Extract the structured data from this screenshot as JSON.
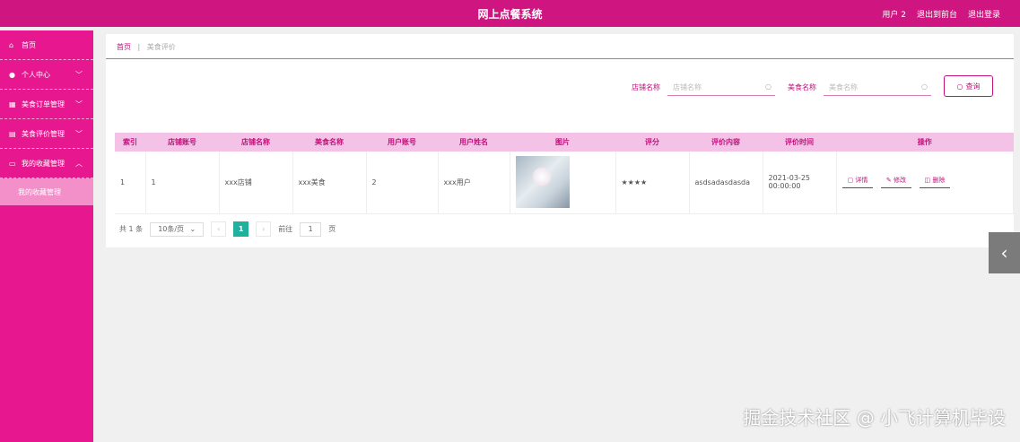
{
  "header": {
    "title": "网上点餐系统",
    "user": "用户 2",
    "exit_console": "退出到前台",
    "logout": "退出登录"
  },
  "sidebar": {
    "items": [
      {
        "icon": "home-icon",
        "label": "首页",
        "arrow": ""
      },
      {
        "icon": "user-icon",
        "label": "个人中心",
        "arrow": "﹀"
      },
      {
        "icon": "order-icon",
        "label": "美食订单管理",
        "arrow": "﹀"
      },
      {
        "icon": "review-icon",
        "label": "美食评价管理",
        "arrow": "﹀"
      },
      {
        "icon": "collect-icon",
        "label": "我的收藏管理",
        "arrow": "︿"
      }
    ],
    "sub_item": "我的收藏管理"
  },
  "breadcrumb": {
    "home": "首页",
    "sep": "|",
    "current": "美食评价"
  },
  "search": {
    "shop_label": "店铺名称",
    "shop_placeholder": "店铺名称",
    "food_label": "美食名称",
    "food_placeholder": "美食名称",
    "query_button": "查询"
  },
  "table": {
    "headers": [
      "索引",
      "店铺账号",
      "店铺名称",
      "美食名称",
      "用户账号",
      "用户姓名",
      "图片",
      "评分",
      "评价内容",
      "评价时间",
      "操作"
    ],
    "rows": [
      {
        "index": "1",
        "shop_account": "1",
        "shop_name": "xxx店铺",
        "food_name": "xxx美食",
        "user_account": "2",
        "user_name": "xxx用户",
        "rating": "★★★★",
        "content": "asdsadasdasda",
        "time": "2021-03-25 00:00:00",
        "actions": {
          "detail": "详情",
          "edit": "修改",
          "delete": "删除"
        }
      }
    ]
  },
  "pager": {
    "total": "共 1 条",
    "page_size": "10条/页",
    "prev": "‹",
    "current": "1",
    "next": "›",
    "goto_label": "前往",
    "goto_value": "1",
    "page_unit": "页"
  },
  "watermark": "掘金技术社区 @ 小飞计算机毕设",
  "colors": {
    "primary": "#cf1680",
    "sidebar": "#e7178f",
    "header_row": "#f4c1e7",
    "pager_active": "#1fb19e"
  }
}
